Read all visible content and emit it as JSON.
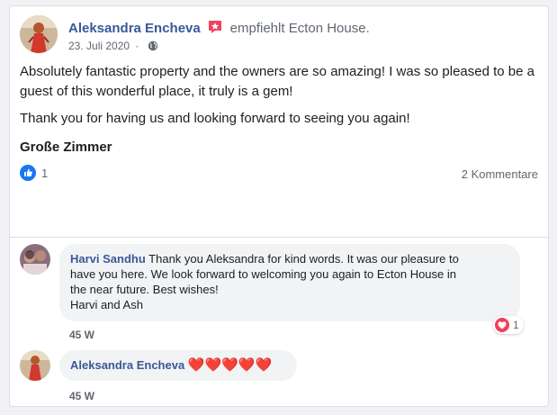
{
  "post": {
    "author": "Aleksandra Encheva",
    "recommends_text": "empfiehlt Ecton House.",
    "date": "23. Juli 2020",
    "separator": "·",
    "body_paragraph_1": "Absolutely fantastic property and the owners are so amazing! I was so pleased to be a guest of this wonderful place, it truly is a gem!",
    "body_paragraph_2": "Thank you for having us and looking forward to seeing you again!",
    "tag": "Große Zimmer",
    "like_count": "1",
    "comments_link": "2 Kommentare",
    "icons": [
      "recommendation-star-icon",
      "globe-icon",
      "like-thumb-icon"
    ],
    "colors": {
      "link_blue": "#385898",
      "recommend_pink": "#f3425f",
      "like_blue": "#1877f2"
    }
  },
  "comments": [
    {
      "author": "Harvi Sandhu",
      "text_line_1": " Thank you Aleksandra for kind words. It was our pleasure to",
      "text_line_2": "have you here. We look forward to welcoming you again to Ecton House in",
      "text_line_3": "the near future. Best wishes!",
      "text_line_4": "Harvi and Ash",
      "age": "45 W",
      "reaction_count": "1",
      "reaction_icon": "heart-icon"
    },
    {
      "author": "Aleksandra Encheva",
      "text": "❤️❤️❤️❤️❤️",
      "age": "45 W"
    }
  ]
}
